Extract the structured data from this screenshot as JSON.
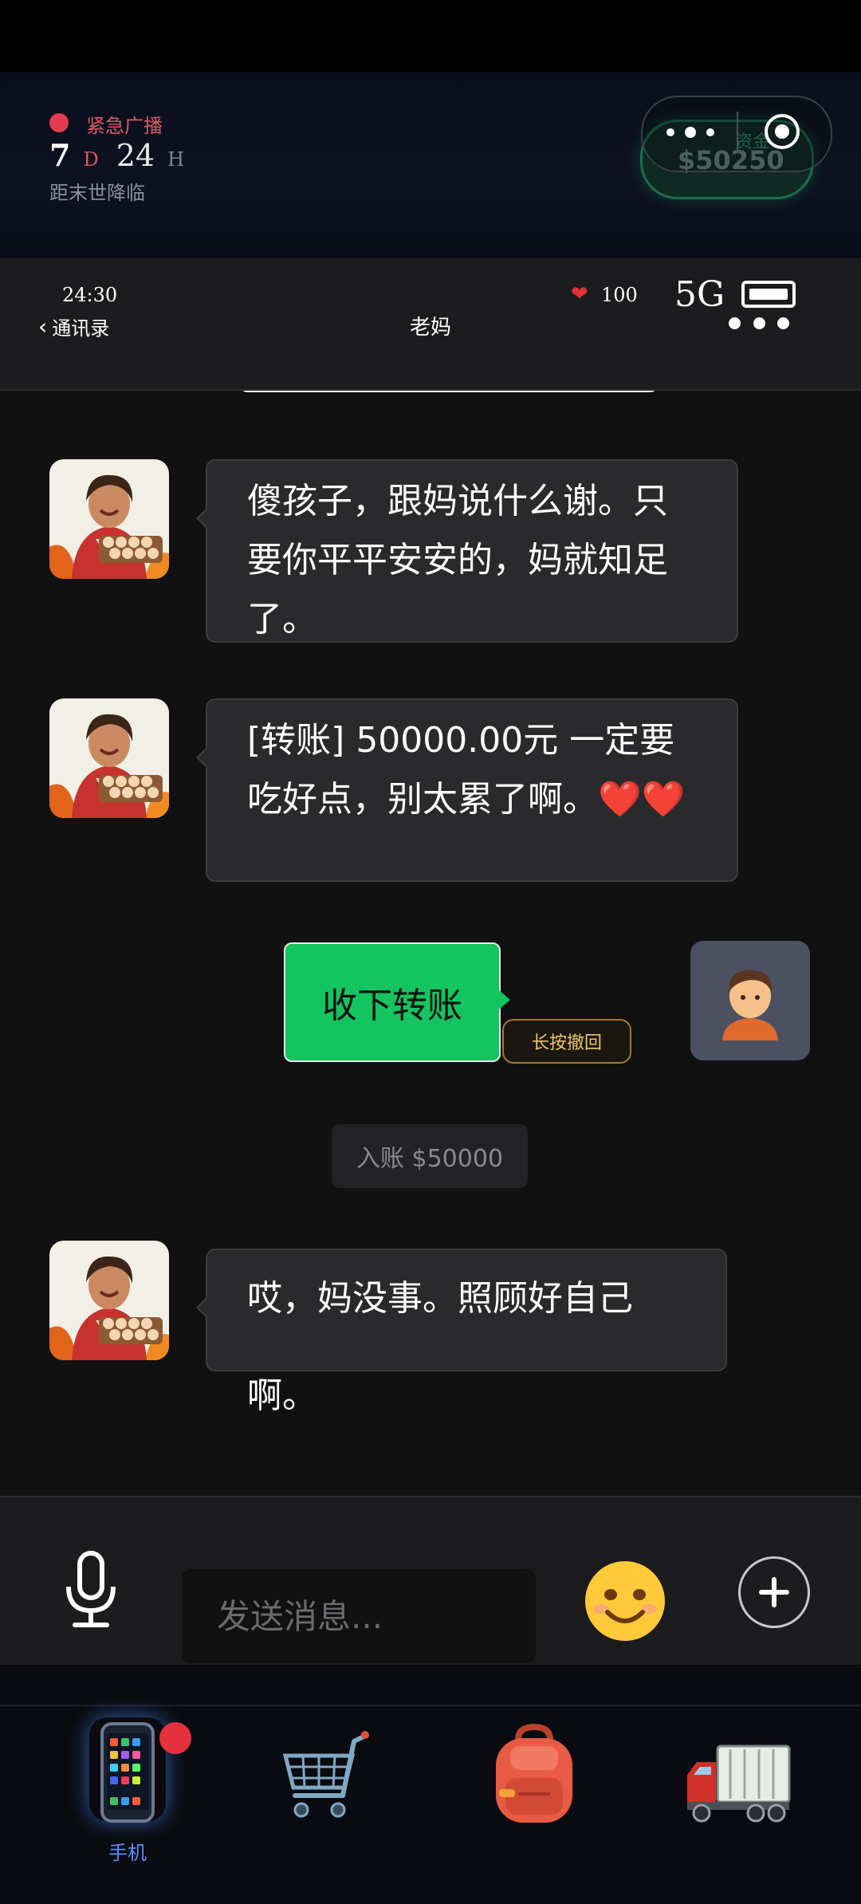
{
  "broadcast": {
    "label": "紧急广播",
    "days": "7",
    "days_unit": "D",
    "hours": "24",
    "hours_unit": "H",
    "subtitle": "距末世降临"
  },
  "funds": {
    "label": "资金",
    "amount": "$50250"
  },
  "status": {
    "time": "24:30",
    "hp": "100",
    "network": "5G"
  },
  "nav": {
    "back_label": "通讯录",
    "title": "老妈"
  },
  "messages": [
    {
      "from": "mom",
      "text": "傻孩子，跟妈说什么谢。只要你平平安安的，妈就知足了。"
    },
    {
      "from": "mom",
      "text": "[转账] 50000.00元 一定要吃好点，别太累了啊。",
      "hearts": "❤️❤️"
    },
    {
      "from": "me",
      "text": "收下转账",
      "tag": "长按撤回"
    },
    {
      "from": "system",
      "text": "入账 $50000"
    },
    {
      "from": "mom",
      "text": "哎，妈没事。照顾好自己啊。"
    }
  ],
  "input": {
    "placeholder": "发送消息..."
  },
  "tabs": [
    {
      "label": "手机",
      "icon": "phone-icon",
      "active": true
    },
    {
      "label": "",
      "icon": "shopping-cart-icon"
    },
    {
      "label": "",
      "icon": "backpack-icon"
    },
    {
      "label": "",
      "icon": "truck-icon"
    }
  ],
  "colors": {
    "accent_green": "#13c45f",
    "alert_red": "#e23b4e",
    "tab_active": "#5b8dff",
    "recall_gold": "#f0c56a"
  }
}
